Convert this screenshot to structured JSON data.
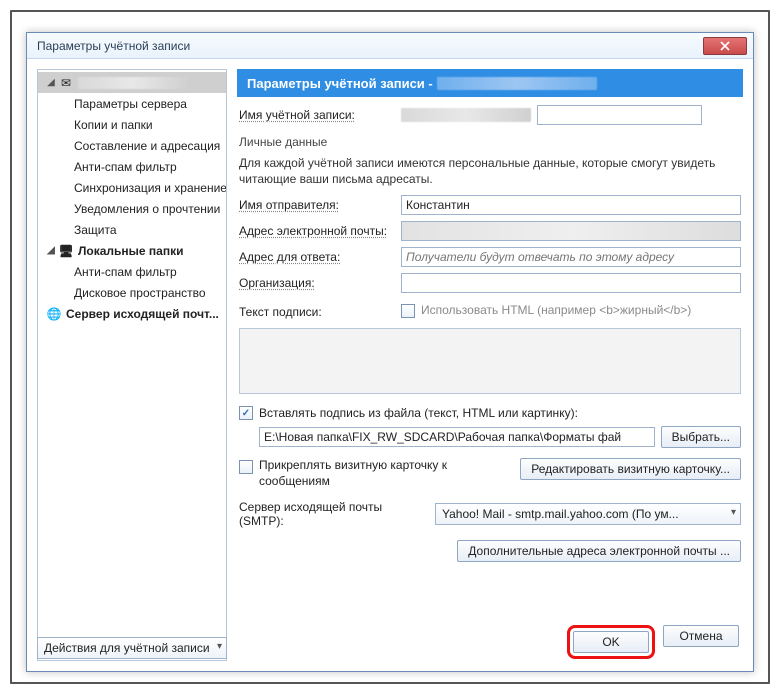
{
  "window": {
    "title": "Параметры учётной записи"
  },
  "tree": {
    "account_items": [
      "Параметры сервера",
      "Копии и папки",
      "Составление и адресация",
      "Анти-спам фильтр",
      "Синхронизация и хранение",
      "Уведомления о прочтении",
      "Защита"
    ],
    "local_folders_label": "Локальные папки",
    "local_items": [
      "Анти-спам фильтр",
      "Дисковое пространство"
    ],
    "smtp_label": "Сервер исходящей почт..."
  },
  "banner": {
    "prefix": "Параметры учётной записи - "
  },
  "fields": {
    "account_name_label": "Имя учётной записи:",
    "group_title": "Личные данные",
    "group_desc": "Для каждой учётной записи имеются персональные данные, которые смогут увидеть читающие ваши письма адресаты.",
    "sender_name_label": "Имя отправителя:",
    "sender_name_value": "Константин",
    "email_label": "Адрес электронной почты:",
    "reply_label": "Адрес для ответа:",
    "reply_placeholder": "Получатели будут отвечать по этому адресу",
    "org_label": "Организация:",
    "sig_label": "Текст подписи:",
    "use_html_label": "Использовать HTML (например <b>жирный</b>)",
    "attach_sig_label": "Вставлять подпись из файла (текст, HTML или картинку):",
    "sig_path": "E:\\Новая папка\\FIX_RW_SDCARD\\Рабочая папка\\Форматы фай",
    "browse_label": "Выбрать...",
    "vcard_label": "Прикреплять визитную карточку к сообщениям",
    "vcard_edit_label": "Редактировать визитную карточку...",
    "smtp_label": "Сервер исходящей почты (SMTP):",
    "smtp_value": "Yahoo! Mail - smtp.mail.yahoo.com (По ум...",
    "extra_addr_label": "Дополнительные адреса электронной почты ..."
  },
  "buttons": {
    "account_actions": "Действия для учётной записи",
    "ok": "OK",
    "cancel": "Отмена"
  }
}
